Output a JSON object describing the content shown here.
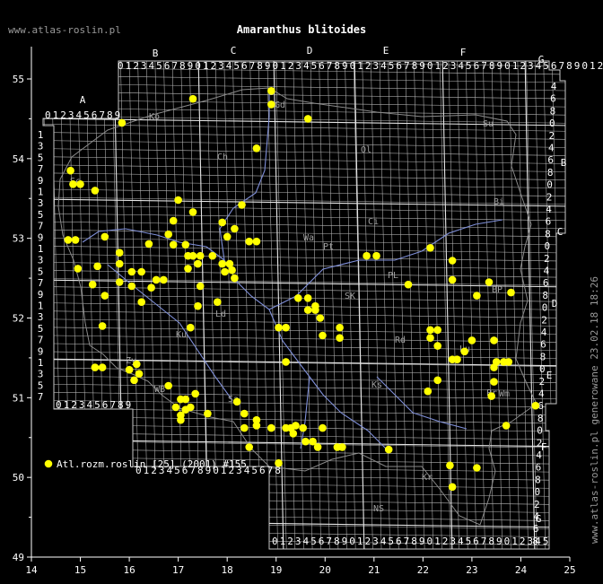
{
  "title": "Amaranthus blitoides",
  "site": "www.atlas-roslin.pl",
  "generated": "www.atlas-roslin.pl generowane 23.02.18 18:26",
  "legend": {
    "label": "Atl.rozm.roslin [25] (2001) #155",
    "color": "#ffff00"
  },
  "colors": {
    "background": "#000000",
    "grid": "#b8b8b8",
    "border": "#8a8a8a",
    "river": "#7f8fd8",
    "point": "#ffff00"
  },
  "x_ticks": [
    "14",
    "15",
    "16",
    "17",
    "18",
    "19",
    "20",
    "21",
    "22",
    "23",
    "24",
    "25"
  ],
  "y_ticks": [
    "55",
    "54",
    "53",
    "52",
    "51",
    "50",
    "49"
  ],
  "columns": [
    "A",
    "B",
    "C",
    "D",
    "E",
    "F",
    "G"
  ],
  "rows": [
    "A",
    "B",
    "C",
    "D",
    "E",
    "F",
    "G"
  ],
  "col_digits_top": "0123456789012345678901234567890123456789012345678901234567890123456789",
  "col_digits_a": "0123456789",
  "col_digits_bottom_left": "0123456789",
  "col_digits_bottom_mid": "0123456789012345678",
  "col_digits_bottom_right": "012345678901234567890123456789012345",
  "right_row_digits": [
    "4",
    "6",
    "8",
    "0",
    "2",
    "4",
    "6",
    "8",
    "0",
    "2",
    "4",
    "6",
    "8",
    "0",
    "2",
    "4",
    "6",
    "8",
    "0",
    "2",
    "4",
    "6",
    "8",
    "0",
    "2",
    "4",
    "6",
    "8",
    "0",
    "2",
    "4",
    "6",
    "8",
    "0",
    "2",
    "4",
    "6",
    "8"
  ],
  "left_row_digits": [
    "1",
    "3",
    "5",
    "7",
    "9",
    "1",
    "3",
    "5",
    "7",
    "9",
    "1",
    "3",
    "5",
    "7",
    "9",
    "1",
    "3",
    "5",
    "7",
    "9",
    "1",
    "3",
    "5",
    "7",
    "9",
    "1",
    "3",
    "5",
    "7",
    "9",
    "1",
    "3",
    "5",
    "7",
    "9"
  ],
  "regions": [
    "Ko",
    "Ch",
    "Ol",
    "Su",
    "Bi",
    "Ci",
    "Pt",
    "PL",
    "SK",
    "Ks",
    "Rd",
    "Ld",
    "Ku",
    "Wa",
    "Kr",
    "NS",
    "Pr",
    "Gd",
    "Zy",
    "Sc",
    "WB",
    "BP",
    "Wm",
    "Lu",
    "Sa"
  ],
  "chart_data": {
    "type": "scatter",
    "xlabel": "",
    "ylabel": "",
    "xlim": [
      14,
      25
    ],
    "ylim": [
      49,
      55.2
    ],
    "series": [
      {
        "name": "Atl.rozm.roslin [25] (2001) #155",
        "points": [
          [
            15.85,
            54.45
          ],
          [
            17.3,
            54.75
          ],
          [
            18.9,
            54.85
          ],
          [
            18.9,
            54.68
          ],
          [
            19.65,
            54.5
          ],
          [
            18.6,
            54.13
          ],
          [
            14.8,
            53.85
          ],
          [
            14.85,
            53.68
          ],
          [
            15,
            53.68
          ],
          [
            15.3,
            53.6
          ],
          [
            17,
            53.48
          ],
          [
            17.3,
            53.33
          ],
          [
            18.3,
            53.42
          ],
          [
            14.75,
            52.98
          ],
          [
            14.9,
            52.98
          ],
          [
            15.5,
            53.02
          ],
          [
            15.8,
            52.82
          ],
          [
            15.8,
            52.68
          ],
          [
            14.95,
            52.62
          ],
          [
            15.35,
            52.65
          ],
          [
            16.05,
            52.58
          ],
          [
            16.25,
            52.58
          ],
          [
            16.4,
            52.93
          ],
          [
            16.55,
            52.48
          ],
          [
            16.7,
            52.48
          ],
          [
            16.8,
            53.05
          ],
          [
            16.9,
            53.22
          ],
          [
            16.9,
            52.92
          ],
          [
            17.15,
            52.92
          ],
          [
            17.2,
            52.78
          ],
          [
            17.3,
            52.78
          ],
          [
            17.45,
            52.78
          ],
          [
            17.2,
            52.62
          ],
          [
            17.4,
            52.68
          ],
          [
            17.45,
            52.4
          ],
          [
            17.7,
            52.78
          ],
          [
            17.9,
            53.2
          ],
          [
            18,
            53.02
          ],
          [
            18.15,
            53.12
          ],
          [
            17.9,
            52.68
          ],
          [
            18.05,
            52.68
          ],
          [
            17.95,
            52.58
          ],
          [
            18.1,
            52.6
          ],
          [
            18.15,
            52.5
          ],
          [
            18.45,
            52.96
          ],
          [
            18.6,
            52.96
          ],
          [
            16.25,
            52.2
          ],
          [
            16.05,
            52.4
          ],
          [
            16.45,
            52.38
          ],
          [
            15.5,
            52.28
          ],
          [
            15.25,
            52.42
          ],
          [
            15.8,
            52.45
          ],
          [
            17.4,
            52.15
          ],
          [
            17.8,
            52.2
          ],
          [
            17.25,
            51.88
          ],
          [
            15.45,
            51.9
          ],
          [
            19.45,
            52.25
          ],
          [
            19.65,
            52.25
          ],
          [
            19.65,
            52.1
          ],
          [
            19.8,
            52.1
          ],
          [
            19.8,
            52.15
          ],
          [
            19.9,
            52.0
          ],
          [
            19.05,
            51.88
          ],
          [
            19.2,
            51.88
          ],
          [
            19.95,
            51.78
          ],
          [
            20.3,
            51.88
          ],
          [
            20.3,
            51.75
          ],
          [
            19.2,
            51.45
          ],
          [
            15.3,
            51.38
          ],
          [
            15.45,
            51.38
          ],
          [
            16,
            51.35
          ],
          [
            16.15,
            51.42
          ],
          [
            16.2,
            51.3
          ],
          [
            16.1,
            51.22
          ],
          [
            17.35,
            51.05
          ],
          [
            16.8,
            51.15
          ],
          [
            16.95,
            50.88
          ],
          [
            17.05,
            50.98
          ],
          [
            17.15,
            50.98
          ],
          [
            17.05,
            50.78
          ],
          [
            17.15,
            50.85
          ],
          [
            17.25,
            50.88
          ],
          [
            17.05,
            50.72
          ],
          [
            17.6,
            50.8
          ],
          [
            18.2,
            50.95
          ],
          [
            18.35,
            50.8
          ],
          [
            18.35,
            50.62
          ],
          [
            18.6,
            50.65
          ],
          [
            18.6,
            50.72
          ],
          [
            18.9,
            50.62
          ],
          [
            19.2,
            50.62
          ],
          [
            19.3,
            50.62
          ],
          [
            19.4,
            50.65
          ],
          [
            19.55,
            50.62
          ],
          [
            19.35,
            50.55
          ],
          [
            19.6,
            50.45
          ],
          [
            19.75,
            50.45
          ],
          [
            19.85,
            50.38
          ],
          [
            19.95,
            50.62
          ],
          [
            18.45,
            50.38
          ],
          [
            19.05,
            50.18
          ],
          [
            20.25,
            50.38
          ],
          [
            20.35,
            50.38
          ],
          [
            21.3,
            50.35
          ],
          [
            20.85,
            52.78
          ],
          [
            21.05,
            52.78
          ],
          [
            22.15,
            52.88
          ],
          [
            21.7,
            52.42
          ],
          [
            22.6,
            52.48
          ],
          [
            22.6,
            52.72
          ],
          [
            23.1,
            52.28
          ],
          [
            23.35,
            52.45
          ],
          [
            23.8,
            52.32
          ],
          [
            22.15,
            51.85
          ],
          [
            22.3,
            51.85
          ],
          [
            22.15,
            51.75
          ],
          [
            22.3,
            51.65
          ],
          [
            22.7,
            51.48
          ],
          [
            22.85,
            51.58
          ],
          [
            22.6,
            51.48
          ],
          [
            23,
            51.72
          ],
          [
            23.45,
            51.72
          ],
          [
            23.5,
            51.45
          ],
          [
            23.45,
            51.38
          ],
          [
            23.65,
            51.45
          ],
          [
            23.75,
            51.45
          ],
          [
            23.45,
            51.2
          ],
          [
            23.4,
            51.02
          ],
          [
            23.7,
            50.65
          ],
          [
            22.3,
            51.22
          ],
          [
            22.1,
            51.08
          ],
          [
            24.3,
            50.9
          ],
          [
            22.55,
            50.15
          ],
          [
            23.1,
            50.12
          ],
          [
            22.6,
            49.88
          ]
        ]
      }
    ]
  }
}
